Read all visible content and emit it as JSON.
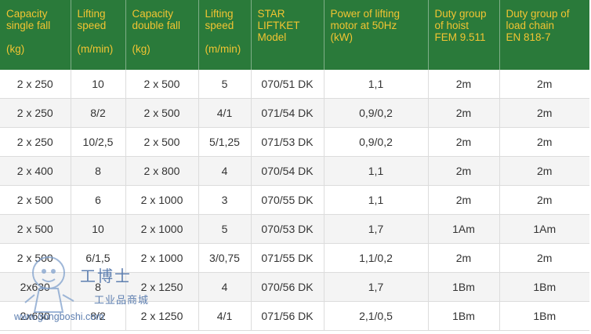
{
  "table": {
    "headers": [
      "Capacity\nsingle fall\n\n(kg)",
      "Lifting\nspeed\n\n(m/min)",
      "Capacity\ndouble fall\n\n(kg)",
      "Lifting\nspeed\n\n(m/min)",
      "STAR\nLIFTKET\nModel",
      "Power of lifting\nmotor at 50Hz\n(kW)",
      "Duty group\nof hoist\nFEM 9.511",
      "Duty group of\nload chain\nEN 818-7"
    ],
    "rows": [
      [
        "2 x 250",
        "10",
        "2 x 500",
        "5",
        "070/51 DK",
        "1,1",
        "2m",
        "2m"
      ],
      [
        "2 x 250",
        "8/2",
        "2 x 500",
        "4/1",
        "071/54 DK",
        "0,9/0,2",
        "2m",
        "2m"
      ],
      [
        "2 x 250",
        "10/2,5",
        "2 x 500",
        "5/1,25",
        "071/53 DK",
        "0,9/0,2",
        "2m",
        "2m"
      ],
      [
        "2 x 400",
        "8",
        "2 x 800",
        "4",
        "070/54 DK",
        "1,1",
        "2m",
        "2m"
      ],
      [
        "2 x 500",
        "6",
        "2 x 1000",
        "3",
        "070/55 DK",
        "1,1",
        "2m",
        "2m"
      ],
      [
        "2 x 500",
        "10",
        "2 x 1000",
        "5",
        "070/53 DK",
        "1,7",
        "1Am",
        "1Am"
      ],
      [
        "2 x 500",
        "6/1,5",
        "2 x 1000",
        "3/0,75",
        "071/55 DK",
        "1,1/0,2",
        "2m",
        "2m"
      ],
      [
        "2x630",
        "8",
        "2 x 1250",
        "4",
        "070/56 DK",
        "1,7",
        "1Bm",
        "1Bm"
      ],
      [
        "2x630",
        "8/2",
        "2 x 1250",
        "4/1",
        "071/56 DK",
        "2,1/0,5",
        "1Bm",
        "1Bm"
      ]
    ]
  },
  "watermark": {
    "brand_cn": "工博士",
    "sub_cn": "工业品商城",
    "url": "www.gongboshi.com"
  },
  "colors": {
    "header_bg": "#2a7a3a",
    "header_text": "#f2c432",
    "watermark": "#5e7fb0"
  }
}
